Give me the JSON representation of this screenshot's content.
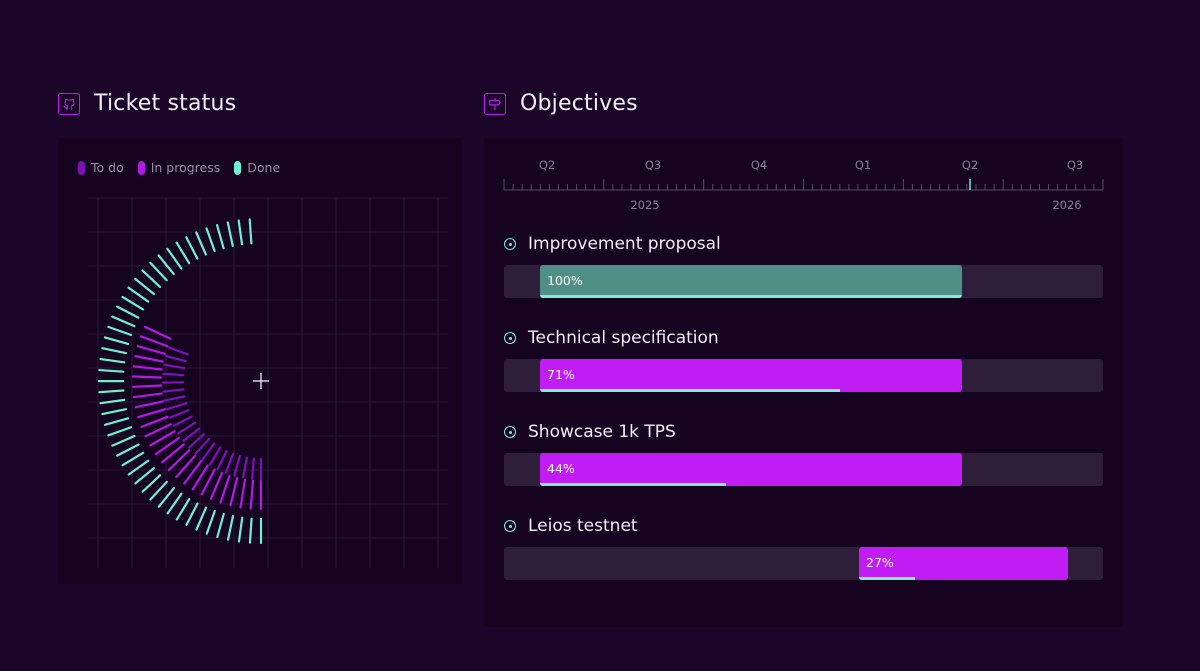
{
  "ticket_status": {
    "title": "Ticket status",
    "icon": "github-icon",
    "legend": [
      {
        "label": "To do",
        "color": "#7d12b8"
      },
      {
        "label": "In progress",
        "color": "#b21ae6"
      },
      {
        "label": "Done",
        "color": "#6ff0d3"
      }
    ]
  },
  "objectives": {
    "title": "Objectives",
    "icon": "signpost-icon",
    "timeline": {
      "quarters": [
        "Q2",
        "Q3",
        "Q4",
        "Q1",
        "Q2",
        "Q3"
      ],
      "years": [
        "2025",
        "2026"
      ]
    },
    "items": [
      {
        "title": "Improvement proposal",
        "label": "100%",
        "progress": 1.0,
        "color": "#4f8f85"
      },
      {
        "title": "Technical specification",
        "label": "71%",
        "progress": 0.71,
        "color": "#c21cf5"
      },
      {
        "title": "Showcase 1k TPS",
        "label": "44%",
        "progress": 0.44,
        "color": "#c21cf5"
      },
      {
        "title": "Leios testnet",
        "label": "27%",
        "progress": 0.27,
        "color": "#c21cf5"
      }
    ]
  },
  "colors": {
    "background": "#1b0528",
    "panel": "#15031f",
    "accent": "#6ff0d3",
    "magenta": "#c21cf5"
  }
}
